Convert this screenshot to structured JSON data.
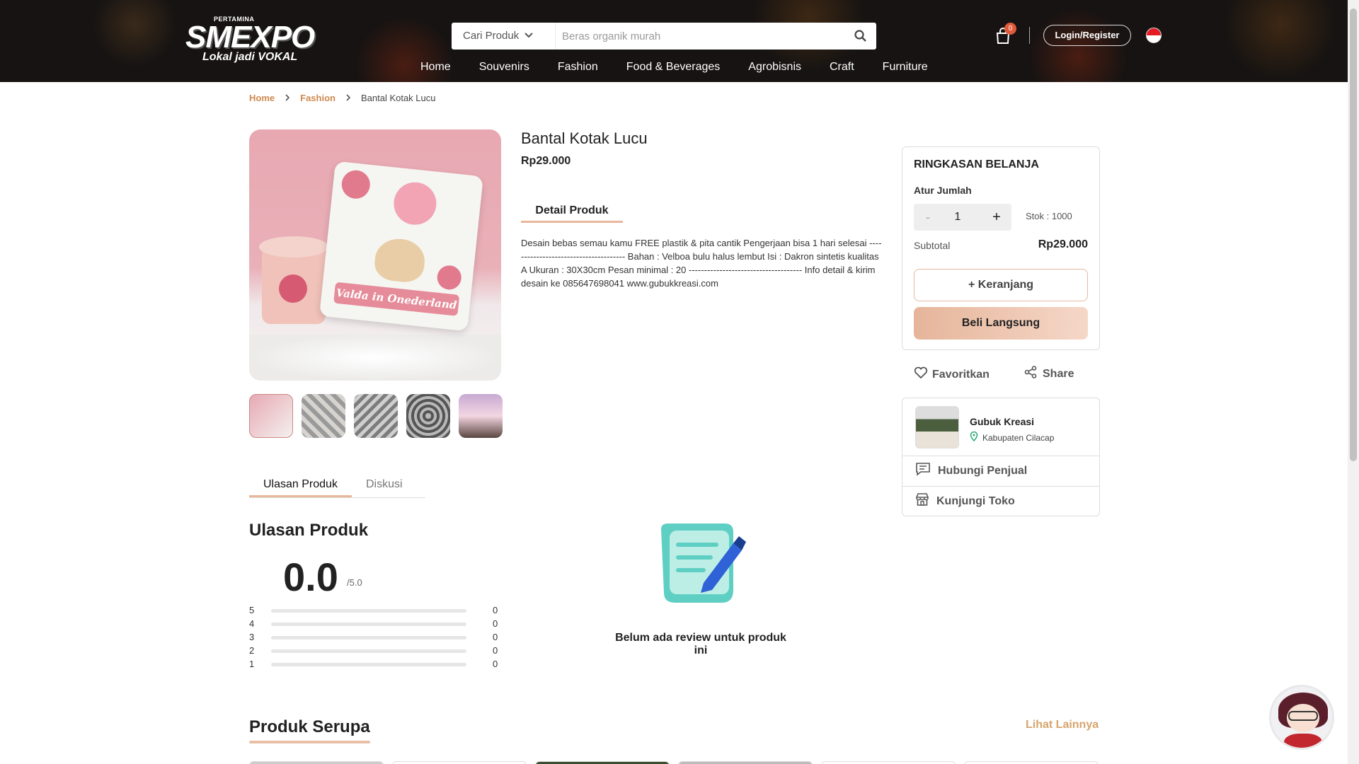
{
  "header": {
    "brand_sub": "PERTAMINA",
    "brand": "SMEXPO",
    "tagline": "Lokal jadi VOKAL",
    "search_category": "Cari Produk",
    "search_placeholder": "Beras organik murah",
    "cart_count": "0",
    "login_label": "Login/Register",
    "nav": [
      "Home",
      "Souvenirs",
      "Fashion",
      "Food & Beverages",
      "Agrobisnis",
      "Craft",
      "Furniture"
    ]
  },
  "breadcrumb": {
    "home": "Home",
    "category": "Fashion",
    "current": "Bantal Kotak Lucu"
  },
  "product": {
    "image_banner_text": "Valda in Onederland",
    "title": "Bantal Kotak Lucu",
    "price": "Rp29.000",
    "detail_tab": "Detail Produk",
    "description": "Desain bebas semau kamu FREE plastik & pita cantik Pengerjaan bisa 1 hari selesai -------------------------------------- Bahan : Velboa bulu halus lembut Isi : Dakron sintetis kualitas A Ukuran : 30X30cm Pesan minimal : 20 ------------------------------------- Info detail & kirim desain ke 085647698041 www.gubukkreasi.com"
  },
  "review_tabs": {
    "reviews": "Ulasan Produk",
    "discussion": "Diskusi"
  },
  "reviews": {
    "title": "Ulasan Produk",
    "score": "0.0",
    "max": "/5.0",
    "rows": [
      {
        "star": "5",
        "count": "0"
      },
      {
        "star": "4",
        "count": "0"
      },
      {
        "star": "3",
        "count": "0"
      },
      {
        "star": "2",
        "count": "0"
      },
      {
        "star": "1",
        "count": "0"
      }
    ],
    "empty_text": "Belum ada review untuk produk ini"
  },
  "summary": {
    "title": "RINGKASAN BELANJA",
    "qty_label": "Atur Jumlah",
    "minus": "-",
    "qty": "1",
    "plus": "+",
    "stock": "Stok : 1000",
    "subtotal_label": "Subtotal",
    "subtotal_value": "Rp29.000",
    "add_cart": "+ Keranjang",
    "buy_now": "Beli Langsung"
  },
  "actions": {
    "favorite": "Favoritkan",
    "share": "Share"
  },
  "seller": {
    "name": "Gubuk Kreasi",
    "location": "Kabupaten Cilacap",
    "contact": "Hubungi Penjual",
    "visit": "Kunjungi Toko"
  },
  "similar": {
    "title": "Produk Serupa",
    "see_more": "Lihat Lainnya"
  },
  "colors": {
    "accent": "#d08a52",
    "button_gradient_start": "#e6b59a",
    "badge": "#e05a3a"
  },
  "icons": [
    "chevron-down-icon",
    "search-icon",
    "cart-icon",
    "flag-icon",
    "chevron-right-icon",
    "heart-icon",
    "share-icon",
    "location-pin-icon",
    "chat-icon",
    "store-icon"
  ]
}
